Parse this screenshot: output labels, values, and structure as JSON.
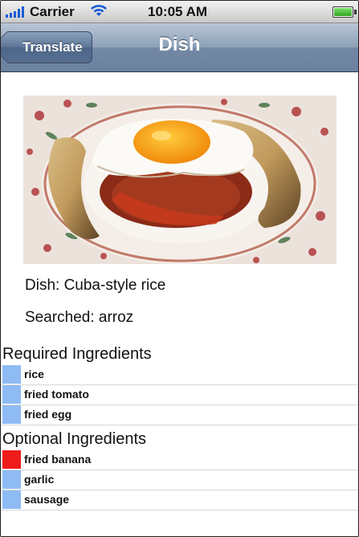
{
  "status_bar": {
    "carrier": "Carrier",
    "time": "10:05 AM",
    "battery_level": 0.9
  },
  "nav": {
    "back_label": "Translate",
    "title": "Dish"
  },
  "dish": {
    "name_line": "Dish: Cuba-style rice",
    "searched_line": "Searched: arroz"
  },
  "required": {
    "header": "Required Ingredients",
    "items": [
      {
        "label": "rice",
        "color": "#8fbbf4"
      },
      {
        "label": "fried tomato",
        "color": "#8fbbf4"
      },
      {
        "label": "fried egg",
        "color": "#8fbbf4"
      }
    ]
  },
  "optional": {
    "header": "Optional Ingredients",
    "items": [
      {
        "label": "fried banana",
        "color": "#ee1b1b"
      },
      {
        "label": "garlic",
        "color": "#8fbbf4"
      },
      {
        "label": "sausage",
        "color": "#8fbbf4"
      }
    ]
  }
}
